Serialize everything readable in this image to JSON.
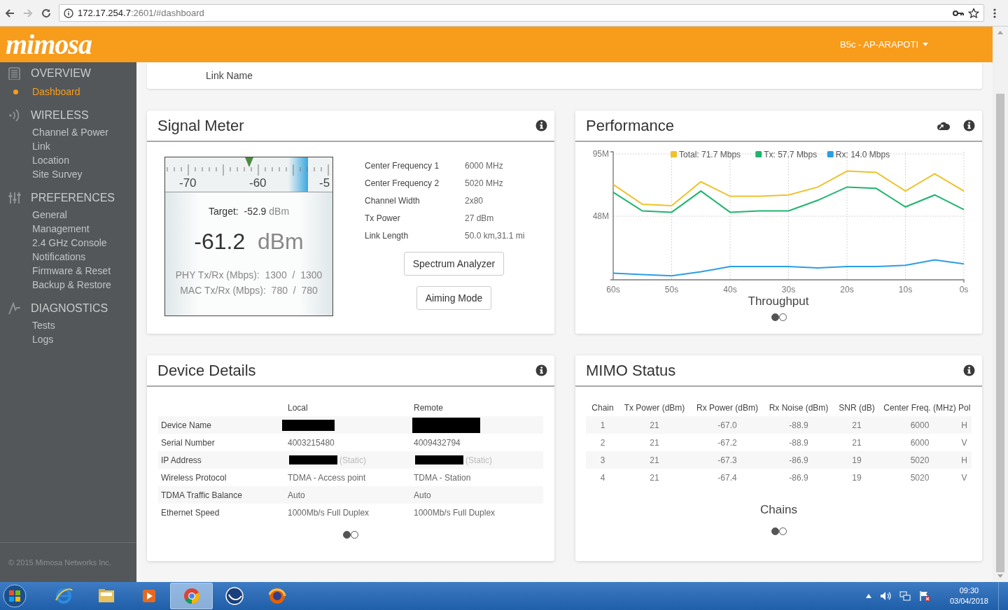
{
  "browser": {
    "url_host": "172.17.254.7",
    "url_rest": ":2601/#dashboard"
  },
  "header": {
    "logo": "mimosa",
    "device_menu": "B5c - AP-ARAPOTI"
  },
  "sidebar": {
    "sections": [
      {
        "kind": "overview",
        "title": "OVERVIEW",
        "items": [
          {
            "label": "Dashboard",
            "selected": true
          }
        ]
      },
      {
        "kind": "wireless",
        "title": "WIRELESS",
        "items": [
          {
            "label": "Channel & Power",
            "selected": false
          },
          {
            "label": "Link",
            "selected": false
          },
          {
            "label": "Location",
            "selected": false
          },
          {
            "label": "Site Survey",
            "selected": false
          }
        ]
      },
      {
        "kind": "preferences",
        "title": "PREFERENCES",
        "items": [
          {
            "label": "General",
            "selected": false
          },
          {
            "label": "Management",
            "selected": false
          },
          {
            "label": "2.4 GHz Console",
            "selected": false
          },
          {
            "label": "Notifications",
            "selected": false
          },
          {
            "label": "Firmware & Reset",
            "selected": false
          },
          {
            "label": "Backup & Restore",
            "selected": false
          }
        ]
      },
      {
        "kind": "diagnostics",
        "title": "DIAGNOSTICS",
        "items": [
          {
            "label": "Tests",
            "selected": false
          },
          {
            "label": "Logs",
            "selected": false
          }
        ]
      }
    ],
    "footer": "© 2015 Mimosa Networks Inc."
  },
  "link_name": {
    "label": "Link Name"
  },
  "signal_meter": {
    "title": "Signal Meter",
    "scale_labels": [
      "-70",
      "-60",
      "-5"
    ],
    "needle": {
      "level": 0.5
    },
    "target_band": {
      "level": 0.85
    },
    "target_label": "Target:",
    "target_value": "-52.9",
    "target_unit": "dBm",
    "reading": "-61.2",
    "reading_unit": "dBm",
    "phy": "PHY Tx/Rx (Mbps):  1300  /  1300",
    "mac": "MAC Tx/Rx (Mbps):  780  /  780",
    "info": [
      {
        "label": "Center Frequency 1",
        "value": "6000 MHz"
      },
      {
        "label": "Center Frequency 2",
        "value": "5020 MHz"
      },
      {
        "label": "Channel Width",
        "value": "2x80"
      },
      {
        "label": "Tx Power",
        "value": "27 dBm"
      },
      {
        "label": "Link Length",
        "value": "50.0 km,31.1 mi"
      }
    ],
    "buttons": [
      "Spectrum Analyzer",
      "Aiming Mode"
    ]
  },
  "performance": {
    "title": "Performance",
    "pager": [
      {
        "selected": true
      },
      {
        "selected": false
      }
    ],
    "chart_data": {
      "type": "line",
      "grid": true,
      "legend": true,
      "xlabel": "Throughput",
      "x": [
        60,
        55,
        50,
        45,
        40,
        35,
        30,
        25,
        20,
        15,
        10,
        5,
        0
      ],
      "xlim": [
        60,
        0
      ],
      "ylim": [
        0,
        95
      ],
      "xticks": [
        {
          "value": 60,
          "label": "60s"
        },
        {
          "value": 50,
          "label": "50s"
        },
        {
          "value": 40,
          "label": "40s"
        },
        {
          "value": 30,
          "label": "30s"
        },
        {
          "value": 20,
          "label": "20s"
        },
        {
          "value": 10,
          "label": "10s"
        },
        {
          "value": 0,
          "label": "0s"
        }
      ],
      "yticks": [
        {
          "value": 95,
          "label": "95M"
        },
        {
          "value": 48,
          "label": "48M"
        }
      ],
      "series": [
        {
          "name": "Total: 71.7 Mbps",
          "color": "#eec22a",
          "values": [
            72,
            57,
            56,
            74,
            63,
            63,
            64,
            70,
            82,
            81,
            67,
            80,
            67
          ]
        },
        {
          "name": "Tx: 57.7 Mbps",
          "color": "#1fb56c",
          "values": [
            66,
            52,
            51,
            67,
            51,
            52,
            52,
            60,
            70,
            69,
            55,
            64,
            53
          ]
        },
        {
          "name": "Rx: 14.0 Mbps",
          "color": "#2a9ee3",
          "values": [
            5,
            4,
            3,
            6,
            10,
            10,
            10,
            9,
            10,
            10,
            11,
            15,
            12
          ]
        }
      ]
    }
  },
  "device_details": {
    "title": "Device Details",
    "columns": [
      "Local",
      "Remote"
    ],
    "rows": [
      {
        "label": "Device Name",
        "local": {
          "redacted": true
        },
        "remote": {
          "redacted": true
        }
      },
      {
        "label": "Serial Number",
        "local": {
          "text": "4003215480"
        },
        "remote": {
          "text": "4009432794"
        }
      },
      {
        "label": "IP Address",
        "local": {
          "redacted": true,
          "note": "(Static)"
        },
        "remote": {
          "redacted": true,
          "note": "(Static)"
        }
      },
      {
        "label": "Wireless Protocol",
        "local": {
          "text": "TDMA - Access point"
        },
        "remote": {
          "text": "TDMA - Station"
        }
      },
      {
        "label": "TDMA Traffic Balance",
        "local": {
          "text": "Auto"
        },
        "remote": {
          "text": "Auto"
        }
      },
      {
        "label": "Ethernet Speed",
        "local": {
          "text": "1000Mb/s Full Duplex"
        },
        "remote": {
          "text": "1000Mb/s Full Duplex"
        }
      }
    ],
    "pager": [
      {
        "selected": true
      },
      {
        "selected": false
      }
    ]
  },
  "mimo_status": {
    "title": "MIMO Status",
    "columns": [
      "Chain",
      "Tx Power (dBm)",
      "Rx Power (dBm)",
      "Rx Noise (dBm)",
      "SNR (dB)",
      "Center Freq. (MHz)",
      "Pol"
    ],
    "rows": [
      [
        "1",
        "21",
        "-67.0",
        "-88.9",
        "21",
        "6000",
        "H"
      ],
      [
        "2",
        "21",
        "-67.2",
        "-88.9",
        "21",
        "6000",
        "V"
      ],
      [
        "3",
        "21",
        "-67.3",
        "-86.9",
        "19",
        "5020",
        "H"
      ],
      [
        "4",
        "21",
        "-67.4",
        "-86.9",
        "19",
        "5020",
        "V"
      ]
    ],
    "caption": "Chains",
    "pager": [
      {
        "selected": true
      },
      {
        "selected": false
      }
    ]
  },
  "taskbar": {
    "apps": [
      {
        "kind": "ie",
        "selected": false
      },
      {
        "kind": "folder",
        "selected": false
      },
      {
        "kind": "media",
        "selected": false
      },
      {
        "kind": "chrome",
        "selected": true
      },
      {
        "kind": "winbox",
        "selected": false
      },
      {
        "kind": "firefox",
        "selected": false
      }
    ],
    "time": "09:30",
    "date": "03/04/2018"
  }
}
